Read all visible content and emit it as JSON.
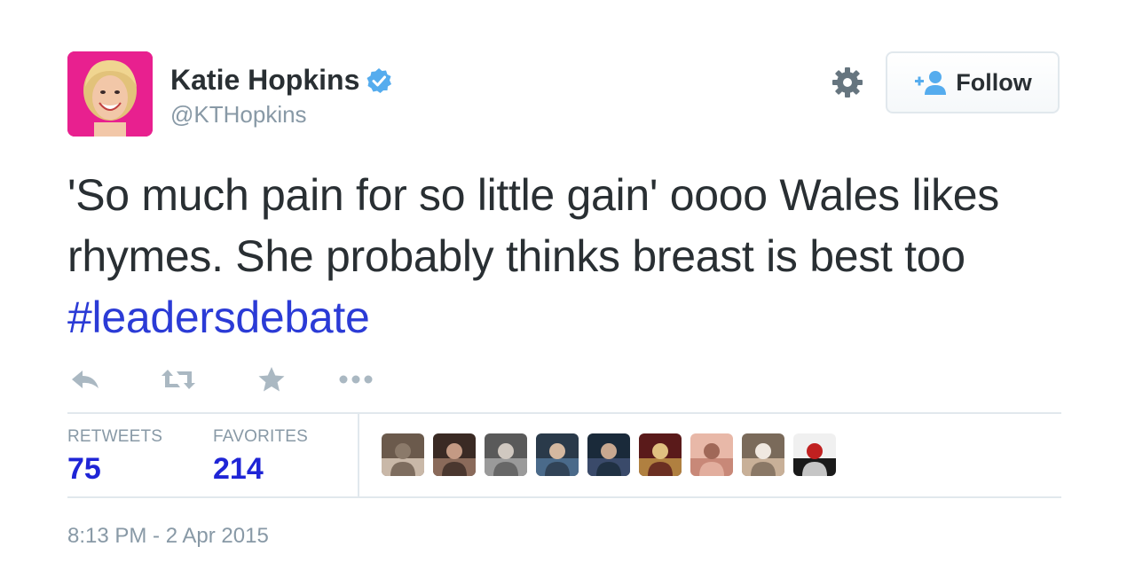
{
  "user": {
    "name": "Katie Hopkins",
    "handle": "@KTHopkins",
    "avatar_bg": "#e8208f",
    "verified": true
  },
  "header": {
    "settings_icon": "gear-icon",
    "follow_label": "Follow",
    "follow_icon": "add-person-icon"
  },
  "tweet": {
    "text": "'So much pain for so little gain' oooo Wales likes rhymes. She probably thinks breast is best too ",
    "hashtag": "#leadersdebate",
    "hashtag_color": "#2b3bd6"
  },
  "actions": [
    "reply-icon",
    "retweet-icon",
    "favorite-icon",
    "more-icon"
  ],
  "stats": {
    "retweets_label": "RETWEETS",
    "retweets_count": "75",
    "favorites_label": "FAVORITES",
    "favorites_count": "214"
  },
  "favoriters": [
    {
      "colors": [
        "#6b5a4c",
        "#c9b8a8",
        "#8b7a6a"
      ]
    },
    {
      "colors": [
        "#3a2a24",
        "#8a6a5a",
        "#c49a84"
      ]
    },
    {
      "colors": [
        "#5a5a5a",
        "#9a9a9a",
        "#d0c8c0"
      ]
    },
    {
      "colors": [
        "#2a3a4a",
        "#4a6a8a",
        "#d4b8a0"
      ]
    },
    {
      "colors": [
        "#1a2a3a",
        "#3a4a6a",
        "#c8a890"
      ]
    },
    {
      "colors": [
        "#5a1a1a",
        "#b08040",
        "#e0c080"
      ]
    },
    {
      "colors": [
        "#e8b8a8",
        "#c88878",
        "#a06858"
      ]
    },
    {
      "colors": [
        "#7a6a5a",
        "#c8b098",
        "#f0e8e0"
      ]
    },
    {
      "colors": [
        "#f0f0f0",
        "#1a1a1a",
        "#c02020"
      ]
    }
  ],
  "timestamp": "8:13 PM - 2 Apr 2015"
}
